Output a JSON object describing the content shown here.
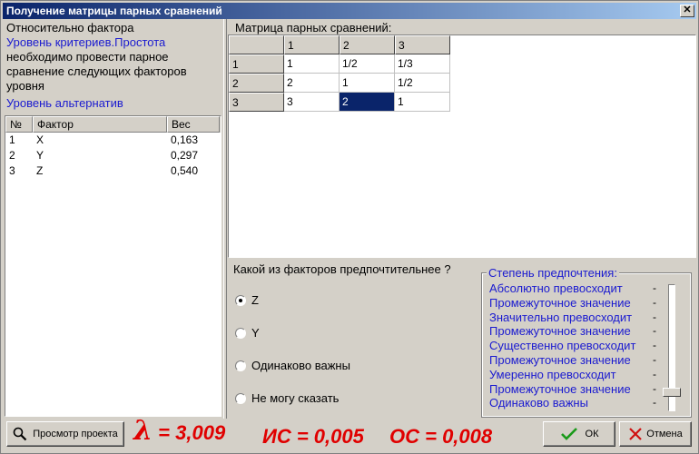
{
  "window": {
    "title": "Получение матрицы парных сравнений",
    "close": "✕"
  },
  "left": {
    "line1": "Относительно фактора",
    "line2": "Уровень критериев.Простота",
    "line3": "необходимо провести парное",
    "line4": "сравнение следующих факторов",
    "line5": "уровня",
    "alt_level": "Уровень альтернатив",
    "table": {
      "headers": [
        "№",
        "Фактор",
        "Вес"
      ],
      "rows": [
        [
          "1",
          "X",
          "0,163"
        ],
        [
          "2",
          "Y",
          "0,297"
        ],
        [
          "3",
          "Z",
          "0,540"
        ]
      ]
    }
  },
  "matrix": {
    "label": "Матрица парных сравнений:",
    "col_headers": [
      "",
      "1",
      "2",
      "3"
    ],
    "rows": [
      {
        "head": "1",
        "cells": [
          "1",
          "1/2",
          "1/3"
        ]
      },
      {
        "head": "2",
        "cells": [
          "2",
          "1",
          "1/2"
        ]
      },
      {
        "head": "3",
        "cells": [
          "3",
          "2",
          "1"
        ]
      }
    ]
  },
  "question": {
    "label": "Какой из факторов предпочтительнее ?",
    "options": [
      "Z",
      "Y",
      "Одинаково важны",
      "Не могу сказать"
    ],
    "selected": "Z"
  },
  "preference": {
    "title": "Степень предпочтения:",
    "items": [
      "Абсолютно превосходит",
      "Промежуточное значение",
      "Значительно превосходит",
      "Промежуточное значение",
      "Существенно превосходит",
      "Промежуточное значение",
      "Умеренно превосходит",
      "Промежуточное значение",
      "Одинаково важны"
    ],
    "tick": "-",
    "level_index": 7
  },
  "bottom": {
    "view_button": "Просмотр проекта",
    "lambda_symbol": "λ",
    "lambda_value": "= 3,009",
    "is_text": "ИС = 0,005",
    "os_text": "ОС = 0,008",
    "ok": "ОК",
    "cancel": "Отмена"
  },
  "colors": {
    "accent_blue": "#1a1ad0",
    "stat_red": "#e00000",
    "selection": "#0a246a"
  }
}
